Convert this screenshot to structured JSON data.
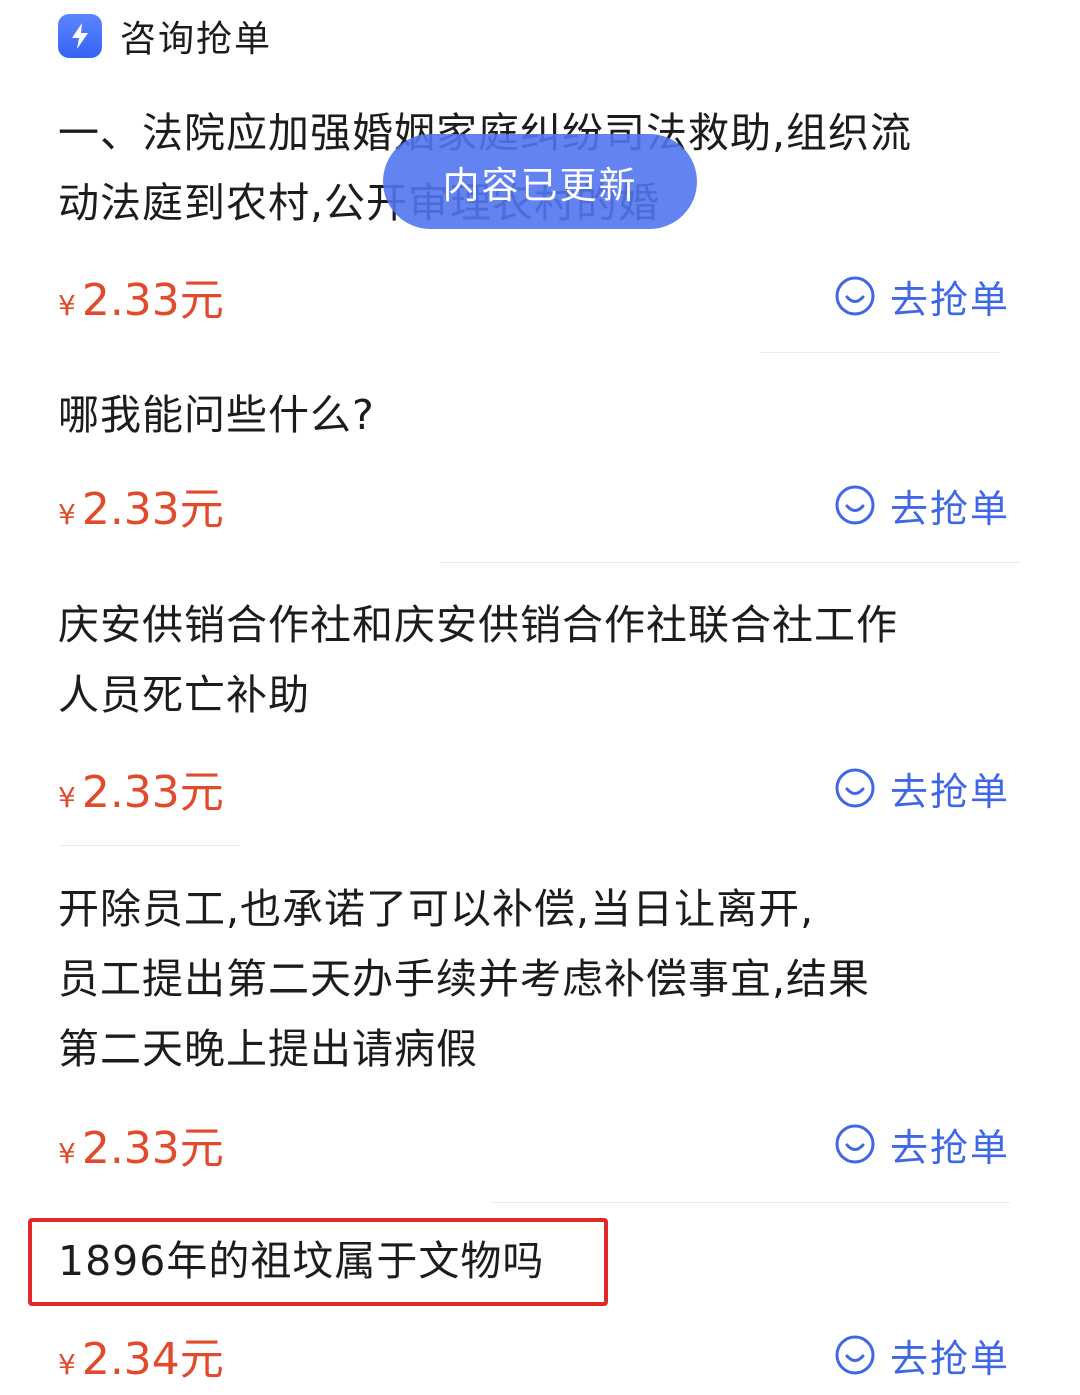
{
  "header": {
    "icon": "lightning-app-icon",
    "title": "咨询抢单"
  },
  "toast": {
    "text": "内容已更新"
  },
  "items": [
    {
      "lines": [
        "一、法院应加强婚姻家庭纠纷司法救助,组织流",
        "动法庭到农村,公开审理农村的婚"
      ],
      "currency": "¥",
      "price": "2.33元",
      "button": "去抢单"
    },
    {
      "lines": [
        "哪我能问些什么?"
      ],
      "currency": "¥",
      "price": "2.33元",
      "button": "去抢单"
    },
    {
      "lines": [
        "庆安供销合作社和庆安供销合作社联合社工作",
        "人员死亡补助"
      ],
      "currency": "¥",
      "price": "2.33元",
      "button": "去抢单"
    },
    {
      "lines": [
        "开除员工,也承诺了可以补偿,当日让离开,",
        "员工提出第二天办手续并考虑补偿事宜,结果",
        "第二天晚上提出请病假"
      ],
      "currency": "¥",
      "price": "2.33元",
      "button": "去抢单"
    },
    {
      "lines": [
        "1896年的祖坟属于文物吗"
      ],
      "currency": "¥",
      "price": "2.34元",
      "button": "去抢单"
    }
  ],
  "colors": {
    "accent": "#3f68e8",
    "price": "#e24a2c",
    "toast": "#5276ee",
    "highlight": "#e0282b"
  },
  "icons": {
    "grab": "smiley-face-icon"
  }
}
